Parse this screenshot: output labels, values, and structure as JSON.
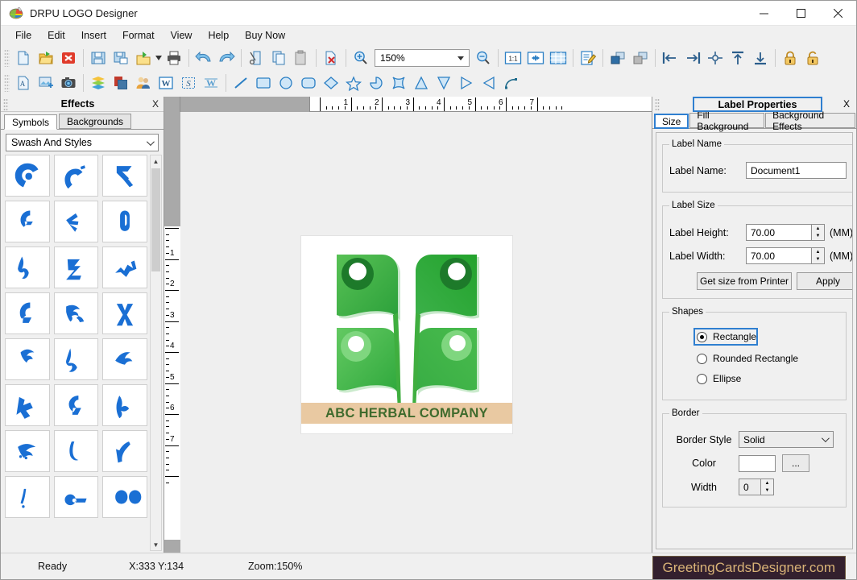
{
  "window": {
    "title": "DRPU LOGO Designer",
    "icon": "app-palette-icon",
    "minimize": "–",
    "maximize": "□",
    "close": "✕"
  },
  "menubar": {
    "items": [
      "File",
      "Edit",
      "Insert",
      "Format",
      "View",
      "Help",
      "Buy Now"
    ]
  },
  "toolbar_main": {
    "zoom_value": "150%",
    "buttons": [
      "new-document-icon",
      "open-folder-icon",
      "close-document-icon",
      "save-icon",
      "save-as-icon",
      "export-folder-icon",
      "print-icon",
      "undo-icon",
      "redo-icon",
      "cut-icon",
      "copy-icon",
      "paste-icon",
      "delete-icon",
      "zoom-in-icon",
      "zoom-out-icon",
      "actual-size-icon",
      "fit-page-icon",
      "grid-icon",
      "edit-properties-icon",
      "bring-forward-icon",
      "send-backward-icon",
      "align-left-icon",
      "align-right-icon",
      "align-center-icon",
      "align-top-icon",
      "align-bottom-icon",
      "lock-icon",
      "unlock-icon"
    ]
  },
  "toolbar_objects": {
    "buttons": [
      "insert-text-icon",
      "insert-image-icon",
      "capture-camera-icon",
      "layers-icon",
      "background-icon",
      "contacts-icon",
      "word-art-icon",
      "signature-icon",
      "watermark-icon",
      "line-tool-icon",
      "rectangle-tool-icon",
      "ellipse-tool-icon",
      "rounded-rect-tool-icon",
      "diamond-tool-icon",
      "star-tool-icon",
      "pie-tool-icon",
      "four-point-star-tool-icon",
      "triangle-up-tool-icon",
      "triangle-down-tool-icon",
      "triangle-right-tool-icon",
      "triangle-left-tool-icon",
      "arc-tool-icon"
    ]
  },
  "effects_panel": {
    "title": "Effects",
    "close_label": "X",
    "tabs": [
      {
        "label": "Symbols",
        "active": true
      },
      {
        "label": "Backgrounds",
        "active": false
      }
    ],
    "category": "Swash And Styles",
    "symbol_count": 24
  },
  "canvas": {
    "ruler_h_labels": [
      "1",
      "2",
      "3",
      "4",
      "5",
      "6",
      "7"
    ],
    "ruler_v_labels": [
      "1",
      "2",
      "3",
      "4",
      "5",
      "6",
      "7"
    ],
    "logo": {
      "company_text": "ABC HERBAL COMPANY",
      "band_color": "#e9c9a2",
      "text_color": "#3f6b2d",
      "leaf_colors": {
        "top_left": "#3fae3f",
        "top_right": "#23a22c",
        "bottom_left": "#4cb94c",
        "bottom_right": "#45b247",
        "dot_dark": "#1d7a2a",
        "dot_light": "#7fd67f"
      }
    }
  },
  "label_properties": {
    "title": "Label Properties",
    "close_label": "X",
    "accent_color": "#2f7fd0",
    "tabs": [
      {
        "label": "Size",
        "active": true
      },
      {
        "label": "Fill Background",
        "active": false
      },
      {
        "label": "Background Effects",
        "active": false
      }
    ],
    "label_name_group": {
      "legend": "Label Name",
      "field_label": "Label Name:",
      "value": "Document1"
    },
    "label_size_group": {
      "legend": "Label Size",
      "height_label": "Label Height:",
      "height_value": "70.00",
      "height_unit": "(MM)",
      "width_label": "Label Width:",
      "width_value": "70.00",
      "width_unit": "(MM)",
      "get_size_button": "Get size from Printer",
      "apply_button": "Apply"
    },
    "shapes_group": {
      "legend": "Shapes",
      "options": [
        {
          "label": "Rectangle",
          "selected": true
        },
        {
          "label": "Rounded Rectangle",
          "selected": false
        },
        {
          "label": "Ellipse",
          "selected": false
        }
      ]
    },
    "border_group": {
      "legend": "Border",
      "style_label": "Border Style",
      "style_value": "Solid",
      "color_label": "Color",
      "color_value": "#ffffff",
      "color_browse_button": "...",
      "width_label": "Width",
      "width_value": "0"
    }
  },
  "statusbar": {
    "state": "Ready",
    "coordinates": "X:333  Y:134",
    "zoom": "Zoom:150%",
    "brand": "GreetingCardsDesigner.com",
    "brand_bg": "#33202e",
    "brand_fg": "#d9b377"
  }
}
